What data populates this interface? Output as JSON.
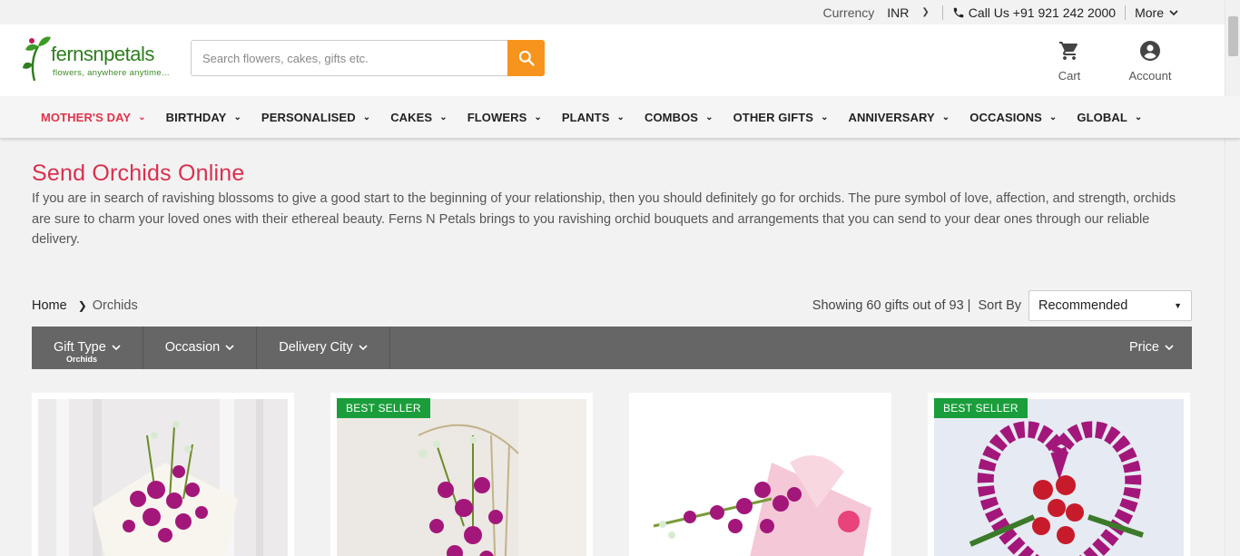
{
  "topbar": {
    "currency_label": "Currency",
    "currency_value": "INR",
    "call_text": "Call Us +91 921 242 2000",
    "more_label": "More"
  },
  "header": {
    "logo_brand": "fernsnpetals",
    "logo_tagline": "flowers, anywhere anytime...",
    "search_placeholder": "Search flowers, cakes, gifts etc.",
    "cart_label": "Cart",
    "account_label": "Account"
  },
  "nav": {
    "items": [
      {
        "label": "MOTHER'S DAY"
      },
      {
        "label": "BIRTHDAY"
      },
      {
        "label": "PERSONALISED"
      },
      {
        "label": "CAKES"
      },
      {
        "label": "FLOWERS"
      },
      {
        "label": "PLANTS"
      },
      {
        "label": "COMBOS"
      },
      {
        "label": "OTHER GIFTS"
      },
      {
        "label": "ANNIVERSARY"
      },
      {
        "label": "OCCASIONS"
      },
      {
        "label": "GLOBAL"
      }
    ]
  },
  "main": {
    "title": "Send Orchids Online",
    "intro": "If you are in search of ravishing blossoms to give a good start to the beginning of your relationship, then you should definitely go for orchids. The pure symbol of love, affection, and strength, orchids are sure to charm your loved ones with their ethereal beauty. Ferns N Petals brings to you ravishing orchid bouquets and arrangements that you can send to your dear ones through our reliable delivery.",
    "breadcrumb": {
      "home": "Home",
      "current": "Orchids"
    },
    "showing": "Showing 60 gifts out of 93 |",
    "sort_label": "Sort By",
    "sort_value": "Recommended",
    "filters": {
      "gift_type": "Gift Type",
      "gift_type_selected": "Orchids",
      "occasion": "Occasion",
      "delivery_city": "Delivery City",
      "price": "Price"
    },
    "products": [
      {
        "badge": ""
      },
      {
        "badge": "BEST SELLER"
      },
      {
        "badge": ""
      },
      {
        "badge": "BEST SELLER"
      }
    ]
  },
  "colors": {
    "accent_red": "#d9304f",
    "search_orange": "#f7941d",
    "badge_green": "#1a9e3b",
    "filter_bar": "#666666"
  }
}
